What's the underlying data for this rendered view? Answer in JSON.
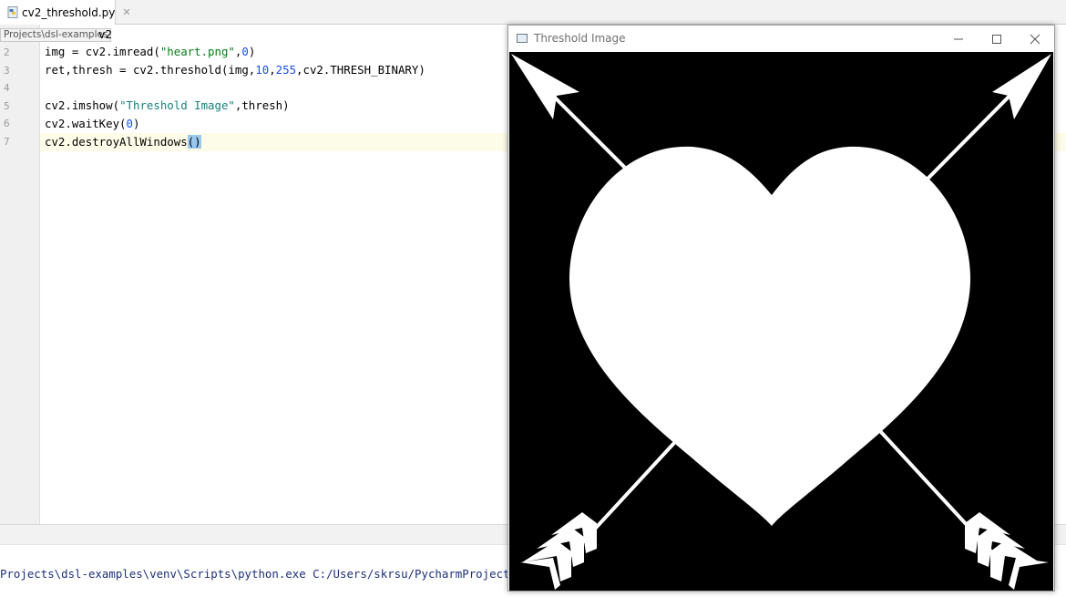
{
  "editor": {
    "tab": {
      "file_name": "cv2_threshold.py",
      "close": "✕"
    },
    "breadcrumb": "Projects\\dsl-examples",
    "line1_tail": "v2",
    "lines": [
      {
        "num": "2"
      },
      {
        "num": "3"
      },
      {
        "num": "4"
      },
      {
        "num": "5"
      },
      {
        "num": "6"
      },
      {
        "num": "7"
      }
    ],
    "code": {
      "l2a": "img = cv2.imread(",
      "l2s": "\"heart.png\"",
      "l2b": ",",
      "l2n": "0",
      "l2c": ")",
      "l3a": "ret,thresh = cv2.threshold(img,",
      "l3n1": "10",
      "l3b": ",",
      "l3n2": "255",
      "l3c": ",cv2.THRESH_BINARY)",
      "l5a": "cv2.imshow(",
      "l5s": "\"Threshold Image\"",
      "l5b": ",thresh)",
      "l6a": "cv2.waitKey(",
      "l6n": "0",
      "l6b": ")",
      "l7a": "cv2.destroyAllWindows",
      "l7b": "()"
    }
  },
  "console": {
    "command": "Projects\\dsl-examples\\venv\\Scripts\\python.exe C:/Users/skrsu/PycharmProjects"
  },
  "window": {
    "title": "Threshold Image",
    "controls": [
      "minimize-icon",
      "maximize-icon",
      "close-icon"
    ],
    "image": "heart-with-arrows"
  },
  "colors": {
    "string": "#067d17",
    "string_alt": "#17817e",
    "number": "#1750eb",
    "current_line": "#fdfce8",
    "paren_highlight": "#99c8ef",
    "console_text": "#1c2f7a"
  }
}
